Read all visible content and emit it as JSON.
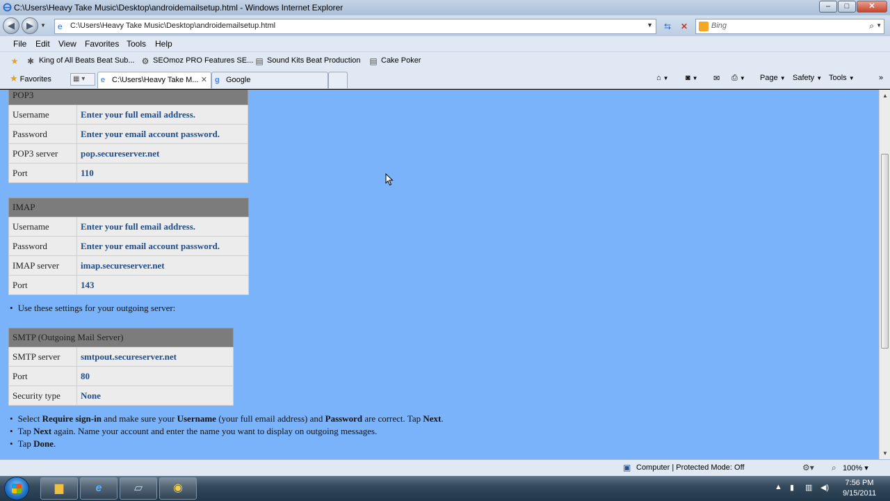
{
  "window": {
    "title": "C:\\Users\\Heavy Take Music\\Desktop\\androidemailsetup.html - Windows Internet Explorer",
    "controls": [
      "–",
      "□",
      "✕"
    ]
  },
  "address_bar": {
    "url": "C:\\Users\\Heavy Take Music\\Desktop\\androidemailsetup.html",
    "search_placeholder": "Bing"
  },
  "menu": [
    "File",
    "Edit",
    "View",
    "Favorites",
    "Tools",
    "Help"
  ],
  "links_bar": [
    "King of All Beats Beat Sub...",
    "SEOmoz PRO Features  SE...",
    "Sound Kits  Beat Production",
    "Cake Poker"
  ],
  "tabs": {
    "favorites_label": "Favorites",
    "active": "C:\\Users\\Heavy Take M...",
    "inactive": "Google"
  },
  "command_bar": [
    "Page",
    "Safety",
    "Tools"
  ],
  "content": {
    "pop3": {
      "header": "POP3",
      "rows": [
        {
          "label": "Username",
          "value": "Enter your full email address."
        },
        {
          "label": "Password",
          "value": "Enter your email account password."
        },
        {
          "label": "POP3 server",
          "value": "pop.secureserver.net"
        },
        {
          "label": "Port",
          "value": "110"
        }
      ]
    },
    "imap": {
      "header": "IMAP",
      "rows": [
        {
          "label": "Username",
          "value": "Enter your full email address."
        },
        {
          "label": "Password",
          "value": "Enter your email account password."
        },
        {
          "label": "IMAP server",
          "value": "imap.secureserver.net"
        },
        {
          "label": "Port",
          "value": "143"
        }
      ]
    },
    "outgoing_note": "Use these settings for your outgoing server:",
    "smtp": {
      "header": "SMTP (Outgoing Mail Server)",
      "rows": [
        {
          "label": "SMTP server",
          "value": "smtpout.secureserver.net"
        },
        {
          "label": "Port",
          "value": "80"
        },
        {
          "label": "Security type",
          "value": "None"
        }
      ]
    },
    "steps": {
      "step1": {
        "a": "Select ",
        "b": "Require sign-in",
        "c": " and make sure your ",
        "d": "Username",
        "e": " (your full email address) and ",
        "f": "Password",
        "g": " are correct. Tap ",
        "h": "Next",
        "i": "."
      },
      "step2": {
        "a": "Tap ",
        "b": "Next",
        "c": " again. Name your account and enter the name you want to display on outgoing messages."
      },
      "step3": {
        "a": "Tap ",
        "b": "Done",
        "c": "."
      }
    }
  },
  "status_bar": {
    "zone": "Computer | Protected Mode: Off",
    "zoom": "100%"
  },
  "taskbar": {
    "time": "7:56 PM",
    "date": "9/15/2011"
  },
  "colors": {
    "page_background": "#7ab3f9",
    "table_header": "#7c7c7c",
    "value_text": "#1f4c8a"
  }
}
